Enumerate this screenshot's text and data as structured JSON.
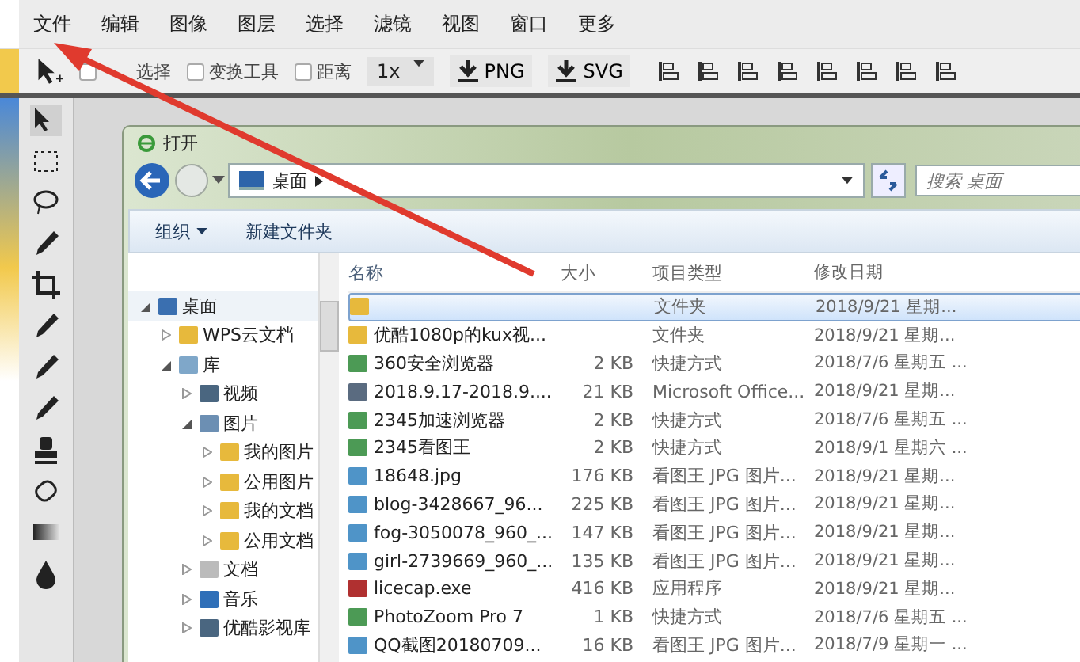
{
  "menu": [
    "文件",
    "编辑",
    "图像",
    "图层",
    "选择",
    "滤镜",
    "视图",
    "窗口",
    "更多"
  ],
  "toolbar": {
    "options": [
      {
        "label": "选择",
        "covered": true,
        "checked": false
      },
      {
        "label": "变换工具",
        "covered": false,
        "checked": false
      },
      {
        "label": "距离",
        "covered": false,
        "checked": false
      }
    ],
    "scale": "1x",
    "exports": [
      "PNG",
      "SVG"
    ]
  },
  "dialog": {
    "title": "打开",
    "location": "桌面",
    "search_placeholder": "搜索 桌面",
    "commands": [
      {
        "label": "组织",
        "dropdown": true
      },
      {
        "label": "新建文件夹",
        "dropdown": false
      }
    ],
    "tree": [
      {
        "label": "桌面",
        "kind": "desktop",
        "expanded": true,
        "selected": true,
        "children": [
          {
            "label": "WPS云文档",
            "kind": "folder",
            "expanded": false,
            "selected": false
          },
          {
            "label": "库",
            "kind": "library",
            "expanded": true,
            "selected": false,
            "children": [
              {
                "label": "视频",
                "kind": "video",
                "expanded": false,
                "selected": false
              },
              {
                "label": "图片",
                "kind": "pictures",
                "expanded": true,
                "selected": false,
                "children": [
                  {
                    "label": "我的图片",
                    "kind": "folder",
                    "expanded": false,
                    "selected": false
                  },
                  {
                    "label": "公用图片",
                    "kind": "folder",
                    "expanded": false,
                    "selected": false
                  },
                  {
                    "label": "我的文档",
                    "kind": "folder",
                    "expanded": false,
                    "selected": false
                  },
                  {
                    "label": "公用文档",
                    "kind": "folder",
                    "expanded": false,
                    "selected": false
                  }
                ]
              },
              {
                "label": "文档",
                "kind": "document",
                "expanded": false,
                "selected": false
              },
              {
                "label": "音乐",
                "kind": "music",
                "expanded": false,
                "selected": false
              },
              {
                "label": "优酷影视库",
                "kind": "video",
                "expanded": false,
                "selected": false
              }
            ]
          }
        ]
      }
    ],
    "columns": [
      "名称",
      "大小",
      "项目类型",
      "修改日期"
    ],
    "files": [
      {
        "kind": "folder",
        "type": "文件夹",
        "date": "2018/9/21 星期...",
        "selected": true
      },
      {
        "kind": "folder",
        "name": "优酷1080p的kux视...",
        "type": "文件夹",
        "date": "2018/9/21 星期...",
        "selected": false
      },
      {
        "kind": "shortcut",
        "name": "360安全浏览器",
        "size": "2 KB",
        "type": "快捷方式",
        "date": "2018/7/6 星期五 ...",
        "selected": false
      },
      {
        "kind": "document",
        "name": "2018.9.17-2018.9....",
        "size": "21 KB",
        "type": "Microsoft Office...",
        "date": "2018/9/21 星期...",
        "selected": false
      },
      {
        "kind": "shortcut",
        "name": "2345加速浏览器",
        "size": "2 KB",
        "type": "快捷方式",
        "date": "2018/7/6 星期五 ...",
        "selected": false
      },
      {
        "kind": "shortcut",
        "name": "2345看图王",
        "size": "2 KB",
        "type": "快捷方式",
        "date": "2018/9/1 星期六 ...",
        "selected": false
      },
      {
        "kind": "image",
        "name": "18648.jpg",
        "size": "176 KB",
        "type": "看图王 JPG 图片...",
        "date": "2018/9/21 星期...",
        "selected": false
      },
      {
        "kind": "image",
        "name": "blog-3428667_96...",
        "size": "225 KB",
        "type": "看图王 JPG 图片...",
        "date": "2018/9/21 星期...",
        "selected": false
      },
      {
        "kind": "image",
        "name": "fog-3050078_960_...",
        "size": "147 KB",
        "type": "看图王 JPG 图片...",
        "date": "2018/9/21 星期...",
        "selected": false
      },
      {
        "kind": "image",
        "name": "girl-2739669_960_...",
        "size": "135 KB",
        "type": "看图王 JPG 图片...",
        "date": "2018/9/21 星期...",
        "selected": false
      },
      {
        "kind": "program",
        "name": "licecap.exe",
        "size": "416 KB",
        "type": "应用程序",
        "date": "2018/9/21 星期...",
        "selected": false
      },
      {
        "kind": "shortcut",
        "name": "PhotoZoom Pro 7",
        "size": "1 KB",
        "type": "快捷方式",
        "date": "2018/7/6 星期五 ...",
        "selected": false
      },
      {
        "kind": "image",
        "name": "QQ截图20180709...",
        "size": "16 KB",
        "type": "看图王 JPG 图片...",
        "date": "2018/7/9 星期一 ...",
        "selected": false
      }
    ]
  }
}
